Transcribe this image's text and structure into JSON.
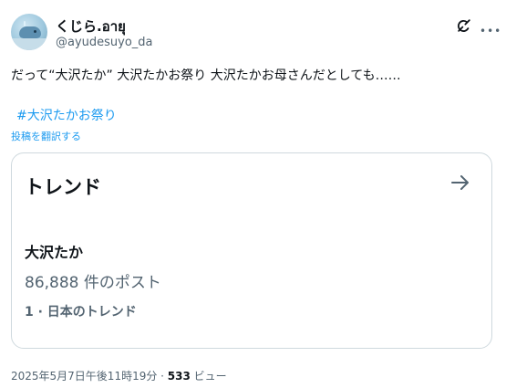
{
  "author": {
    "display_name": "くじら.อายุ",
    "handle": "@ayudesuyo_da"
  },
  "icons": {
    "grok": "grok-icon",
    "more": "more-icon",
    "arrow": "arrow-right-icon"
  },
  "tweet": {
    "text": "だって“大沢たか” 大沢たかお祭り 大沢たかお母さんだとしても……",
    "hashtag": "#大沢たかお祭り",
    "translate_label": "投稿を翻訳する"
  },
  "trend_card": {
    "title": "トレンド",
    "name": "大沢たか",
    "count": "86,888 件のポスト",
    "rank": "1 · 日本のトレンド"
  },
  "meta": {
    "timestamp": "2025年5月7日午後11時19分 · ",
    "views_count": "533",
    "views_label": " ビュー"
  },
  "colors": {
    "link": "#1d9bf0",
    "text": "#0f1419",
    "secondary": "#536471",
    "border": "#cfd9de"
  }
}
